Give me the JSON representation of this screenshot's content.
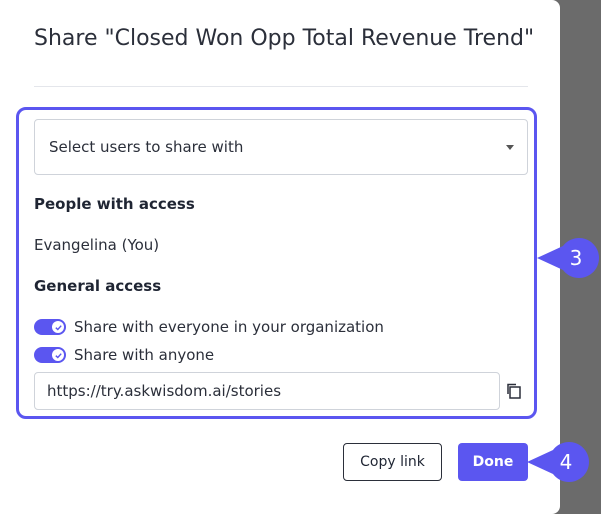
{
  "dialog": {
    "title": "Share \"Closed Won Opp Total Revenue Trend\"",
    "select_placeholder": "Select users to share with",
    "people_heading": "People with access",
    "people": [
      "Evangelina (You)"
    ],
    "general_heading": "General access",
    "toggles": [
      {
        "label": "Share with everyone in your organization",
        "checked": true
      },
      {
        "label": "Share with anyone",
        "checked": true
      }
    ],
    "link_value": "https://try.askwisdom.ai/stories",
    "copy_link_label": "Copy link",
    "done_label": "Done"
  },
  "callouts": {
    "first": "3",
    "second": "4"
  },
  "colors": {
    "accent": "#5b56f0",
    "backdrop": "#6b6b6b"
  }
}
